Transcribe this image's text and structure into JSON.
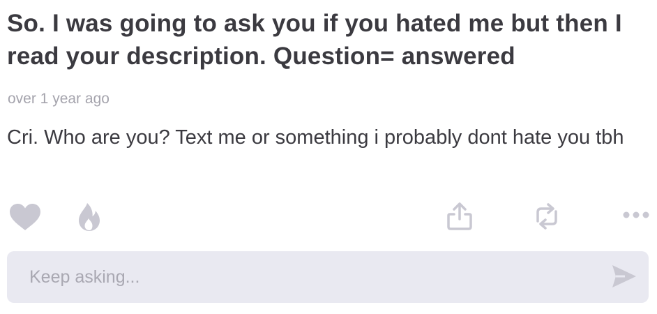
{
  "post": {
    "question": "So. I was going to ask you if you hated me but then I read your description. Question= answered",
    "timestamp": "over 1 year ago",
    "answer": "Cri. Who are you? Text me or something i probably dont hate you tbh"
  },
  "actions": {
    "like_icon": "heart-icon",
    "fire_icon": "fire-icon",
    "share_icon": "share-icon",
    "repost_icon": "repost-icon",
    "more_icon": "more-icon"
  },
  "reply": {
    "placeholder": "Keep asking...",
    "value": "",
    "send_icon": "send-icon"
  },
  "colors": {
    "text": "#3b3a40",
    "muted": "#a5a4ad",
    "icon": "#c9c8d2",
    "input_bg": "#e9e9f1"
  }
}
